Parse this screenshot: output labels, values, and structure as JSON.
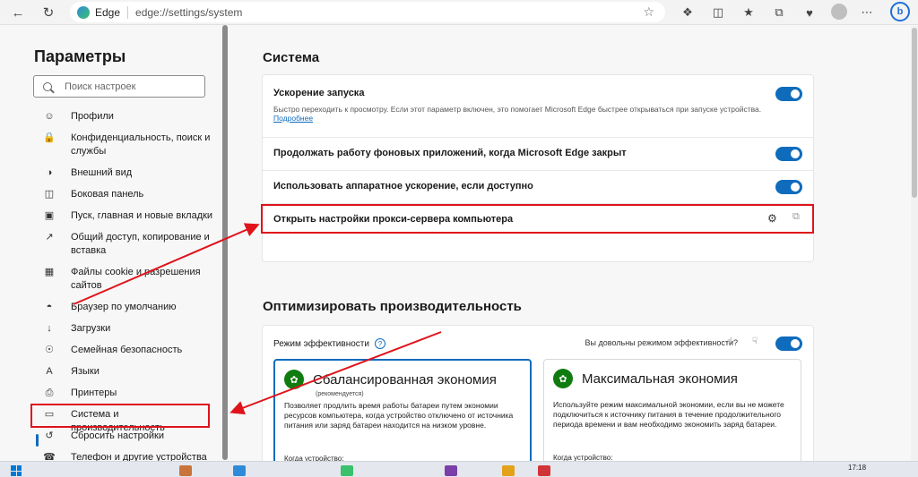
{
  "browser": {
    "brand": "Edge",
    "url": "edge://settings/system"
  },
  "sidebar": {
    "title": "Параметры",
    "search_placeholder": "Поиск настроек",
    "items": [
      {
        "label": "Профили",
        "icon": "profile-icon"
      },
      {
        "label": "Конфиденциальность, поиск и службы",
        "icon": "lock-icon"
      },
      {
        "label": "Внешний вид",
        "icon": "palette-icon"
      },
      {
        "label": "Боковая панель",
        "icon": "sidebar-icon"
      },
      {
        "label": "Пуск, главная и новые вкладки",
        "icon": "home-icon"
      },
      {
        "label": "Общий доступ, копирование и вставка",
        "icon": "share-icon"
      },
      {
        "label": "Файлы cookie и разрешения сайтов",
        "icon": "cookie-icon"
      },
      {
        "label": "Браузер по умолчанию",
        "icon": "browser-icon"
      },
      {
        "label": "Загрузки",
        "icon": "download-icon"
      },
      {
        "label": "Семейная безопасность",
        "icon": "family-icon"
      },
      {
        "label": "Языки",
        "icon": "language-icon"
      },
      {
        "label": "Принтеры",
        "icon": "printer-icon"
      },
      {
        "label": "Система и производительность",
        "icon": "laptop-icon",
        "active": true
      },
      {
        "label": "Сбросить настройки",
        "icon": "reset-icon"
      },
      {
        "label": "Телефон и другие устройства",
        "icon": "phone-icon"
      }
    ]
  },
  "system": {
    "title": "Система",
    "startup_boost": {
      "title": "Ускорение запуска",
      "desc": "Быстро переходить к просмотру. Если этот параметр включен, это помогает Microsoft Edge быстрее открываться при запуске устройства.",
      "link": "Подробнее",
      "enabled": true
    },
    "background_apps": {
      "title": "Продолжать работу фоновых приложений, когда Microsoft Edge закрыт",
      "enabled": true
    },
    "hardware_accel": {
      "title": "Использовать аппаратное ускорение, если доступно",
      "enabled": true
    },
    "proxy": {
      "title": "Открыть настройки прокси-сервера компьютера"
    }
  },
  "performance": {
    "title": "Оптимизировать производительность",
    "efficiency_mode": "Режим эффективности",
    "feedback_question": "Вы довольны режимом эффективности?",
    "efficiency_enabled": true,
    "balanced": {
      "title": "Сбалансированная экономия",
      "subtitle": "(рекомендуется)",
      "desc": "Позволяет продлить время работы батареи путем экономии ресурсов компьютера, когда устройство отключено от источника питания или заряд батареи находится на низком уровне.",
      "when": "Когда устройство:"
    },
    "maximum": {
      "title": "Максимальная экономия",
      "desc": "Используйте режим максимальной экономии, если вы не можете подключиться к источнику питания в течение продолжительного периода времени и вам необходимо экономить заряд батареи.",
      "when": "Когда устройство:"
    }
  },
  "taskbar": {
    "time": "17:18"
  },
  "colors": {
    "accent": "#0f6cbd",
    "annotation": "#e0131b"
  }
}
